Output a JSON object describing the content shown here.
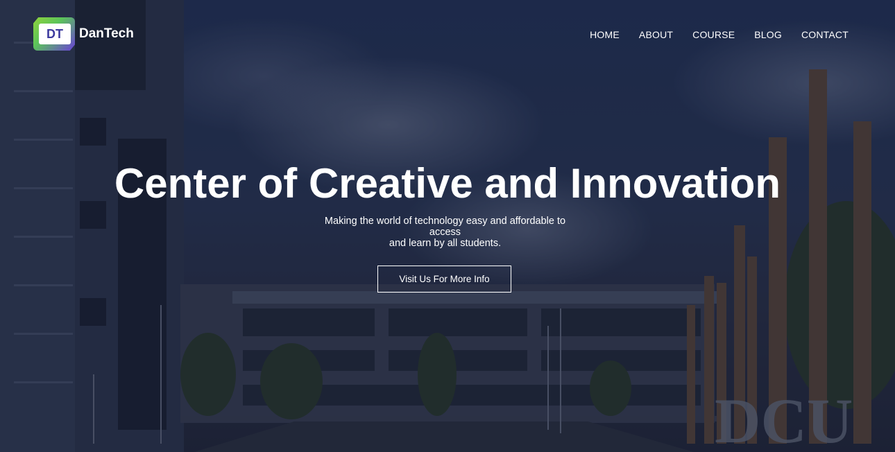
{
  "brand": {
    "logo_letters": "DT",
    "name": "DanTech"
  },
  "nav": {
    "items": [
      {
        "label": "HOME"
      },
      {
        "label": "ABOUT"
      },
      {
        "label": "COURSE"
      },
      {
        "label": "BLOG"
      },
      {
        "label": "CONTACT"
      }
    ]
  },
  "hero": {
    "title": "Center of Creative and Innovation",
    "subtitle_line1": "Making the world of technology easy and affordable to access",
    "subtitle_line2": "and learn by all students.",
    "cta_label": "Visit Us For More Info",
    "sign_text": "DCU"
  },
  "colors": {
    "overlay": "#1e2a46",
    "logo_green": "#8fd33c",
    "logo_purple": "#6a3fd8",
    "text": "#ffffff"
  }
}
